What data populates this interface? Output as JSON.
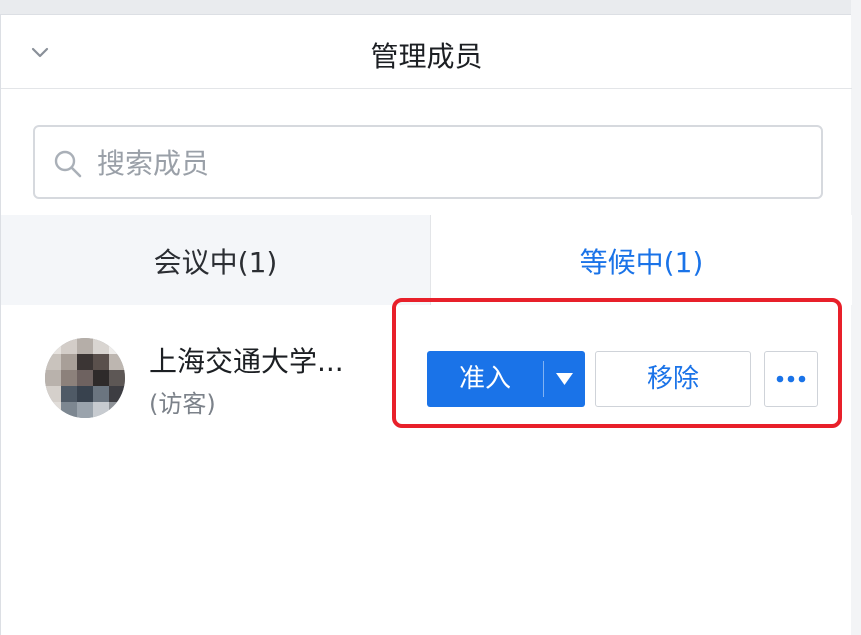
{
  "header": {
    "title": "管理成员",
    "collapse_icon": "chevron-down-icon"
  },
  "search": {
    "placeholder": "搜索成员",
    "value": "",
    "icon": "search-icon"
  },
  "tabs": [
    {
      "label": "会议中(1)",
      "active": false
    },
    {
      "label": "等候中(1)",
      "active": true
    }
  ],
  "waiting_list": [
    {
      "name": "上海交通大学...",
      "role": "(访客)",
      "avatar": "avatar-pixelated",
      "actions": {
        "admit_label": "准入",
        "admit_dropdown_icon": "caret-down-icon",
        "remove_label": "移除",
        "more_icon": "more-icon"
      }
    }
  ],
  "colors": {
    "accent": "#1a73e8",
    "highlight": "#e8202a",
    "active_tab_text": "#1a73e8"
  }
}
